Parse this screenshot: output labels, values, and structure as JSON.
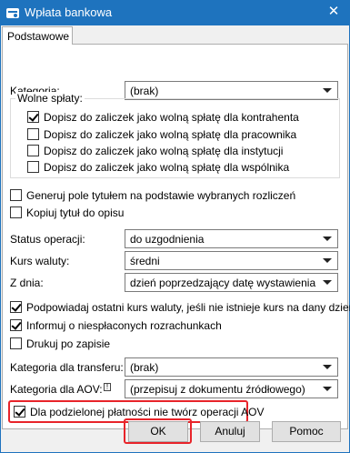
{
  "window": {
    "title": "Wpłata bankowa",
    "close_glyph": "✕",
    "icon": "bank-payment-icon"
  },
  "tabs": [
    {
      "label": "Podstawowe",
      "active": true
    }
  ],
  "kategoria": {
    "label": "Kategoria:",
    "value": "(brak)"
  },
  "wolne_splaty": {
    "legend": "Wolne spłaty:",
    "options": [
      {
        "label": "Dopisz do zaliczek jako wolną spłatę dla kontrahenta",
        "checked": true
      },
      {
        "label": "Dopisz do zaliczek jako wolną spłatę dla pracownika",
        "checked": false
      },
      {
        "label": "Dopisz do zaliczek jako wolną spłatę dla instytucji",
        "checked": false
      },
      {
        "label": "Dopisz do zaliczek jako wolną spłatę dla wspólnika",
        "checked": false
      }
    ]
  },
  "generuj_pole": {
    "label": "Generuj pole tytułem na podstawie wybranych rozliczeń",
    "checked": false
  },
  "kopiuj_tytul": {
    "label": "Kopiuj tytuł do opisu",
    "checked": false
  },
  "status_operacji": {
    "label": "Status operacji:",
    "value": "do uzgodnienia"
  },
  "kurs_waluty": {
    "label": "Kurs waluty:",
    "value": "średni"
  },
  "z_dnia": {
    "label": "Z dnia:",
    "value": "dzień poprzedzający datę wystawienia"
  },
  "podpowiadaj": {
    "label": "Podpowiadaj ostatni kurs waluty, jeśli nie istnieje kurs na dany dzień",
    "checked": true
  },
  "informuj": {
    "label": "Informuj o niespłaconych rozrachunkach",
    "checked": true
  },
  "drukuj": {
    "label": "Drukuj po zapisie",
    "checked": false
  },
  "kategoria_transferu": {
    "label": "Kategoria dla transferu:",
    "value": "(brak)"
  },
  "kategoria_aov": {
    "label": "Kategoria dla AOV:",
    "info_glyph": "!",
    "value": "(przepisuj z dokumentu źródłowego)"
  },
  "podzielona_platnosc": {
    "label": "Dla podzielonej płatności nie twórz operacji AOV",
    "checked": true
  },
  "buttons": {
    "ok": "OK",
    "cancel": "Anuluj",
    "help": "Pomoc"
  },
  "colors": {
    "titlebar": "#1e73be",
    "highlight": "#e8242a",
    "panel": "#ffffff",
    "dialog": "#f0f0f0"
  }
}
